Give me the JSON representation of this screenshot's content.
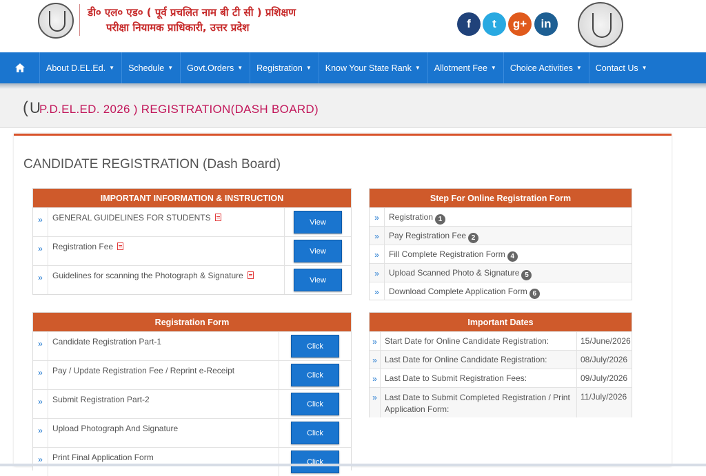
{
  "header": {
    "title_line1": "डी० एल० एड० ( पूर्व प्रचलित नाम बी टी सी ) प्रशिक्षण",
    "title_line2": "परीक्षा नियामक प्राधिकारी, उत्तर प्रदेश",
    "social": [
      {
        "icon": "facebook-icon",
        "glyph": "f"
      },
      {
        "icon": "twitter-icon",
        "glyph": "t"
      },
      {
        "icon": "google-plus-icon",
        "glyph": "g+"
      },
      {
        "icon": "linkedin-icon",
        "glyph": "in"
      }
    ]
  },
  "nav": {
    "items": [
      {
        "label": "About D.EL.Ed."
      },
      {
        "label": "Schedule"
      },
      {
        "label": "Govt.Orders"
      },
      {
        "label": "Registration"
      },
      {
        "label": "Know Your State Rank"
      },
      {
        "label": "Allotment Fee"
      },
      {
        "label": "Choice Activities"
      },
      {
        "label": "Contact Us"
      }
    ]
  },
  "page_title": {
    "open_paren": "(",
    "u": "U",
    "rest": "P.D.EL.ED. 2026 ) REGISTRATION(DASH BOARD)"
  },
  "main": {
    "heading": "CANDIDATE REGISTRATION (Dash Board)",
    "info": {
      "title": "IMPORTANT INFORMATION & INSTRUCTION",
      "rows": [
        {
          "label": "GENERAL GUIDELINES FOR STUDENTS",
          "button": "View"
        },
        {
          "label": "Registration Fee",
          "button": "View"
        },
        {
          "label": "Guidelines for scanning the Photograph & Signature",
          "button": "View"
        }
      ]
    },
    "steps": {
      "title": "Step For Online Registration Form",
      "rows": [
        {
          "label": "Registration",
          "badge": "1"
        },
        {
          "label": "Pay Registration Fee",
          "badge": "2"
        },
        {
          "label": "Fill Complete Registration Form",
          "badge": "4"
        },
        {
          "label": "Upload Scanned Photo & Signature",
          "badge": "5"
        },
        {
          "label": "Download Complete Application Form",
          "badge": "6"
        }
      ]
    },
    "form": {
      "title": "Registration Form",
      "rows": [
        {
          "label": "Candidate Registration Part-1",
          "button": "Click"
        },
        {
          "label": "Pay / Update Registration Fee / Reprint e-Receipt",
          "button": "Click"
        },
        {
          "label": "Submit Registration Part-2",
          "button": "Click"
        },
        {
          "label": "Upload Photograph And Signature",
          "button": "Click"
        },
        {
          "label": "Print Final Application Form",
          "button": "Click"
        }
      ]
    },
    "dates": {
      "title": "Important Dates",
      "rows": [
        {
          "label": "Start Date for Online Candidate Registration:",
          "date": "15/June/2026"
        },
        {
          "label": "Last Date for Online Candidate Registration:",
          "date": "08/July/2026"
        },
        {
          "label": "Last Date to Submit Registration Fees:",
          "date": "09/July/2026"
        },
        {
          "label": "Last Date to Submit Completed Registration / Print Application Form:",
          "date": "11/July/2026"
        }
      ]
    }
  },
  "colors": {
    "nav": "#1a75cf",
    "panel_head": "#cf5a2b",
    "title_accent": "#c2185b",
    "header_text": "#c62828"
  }
}
